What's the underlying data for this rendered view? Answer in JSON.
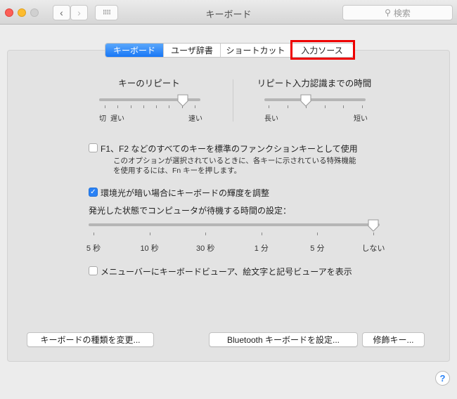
{
  "window": {
    "title": "キーボード",
    "search_placeholder": "検索",
    "colors": {
      "close": "#fc5f57",
      "minimize": "#fdbc2e",
      "zoom": "#d0d0d0",
      "accent": "#1877f6",
      "highlight": "#e00000"
    }
  },
  "tabs": [
    {
      "label": "キーボード",
      "active": true
    },
    {
      "label": "ユーザ辞書",
      "active": false
    },
    {
      "label": "ショートカット",
      "active": false
    },
    {
      "label": "入力ソース",
      "active": false,
      "highlighted": true
    }
  ],
  "key_repeat": {
    "title": "キーのリピート",
    "labels": [
      "切",
      "遅い",
      "速い"
    ],
    "ticks": 8,
    "value_index": 6
  },
  "repeat_delay": {
    "title": "リピート入力認識までの時間",
    "labels": [
      "長い",
      "短い"
    ],
    "ticks": 6,
    "value_index": 2
  },
  "fn_option": {
    "checked": false,
    "label": "F1、F2 などのすべてのキーを標準のファンクションキーとして使用",
    "desc1": "このオプションが選択されているときに、各キーに示されている特殊機能",
    "desc2": "を使用するには、Fn キーを押します。"
  },
  "backlight_option": {
    "checked": true,
    "label": "環境光が暗い場合にキーボードの輝度を調整"
  },
  "idle": {
    "label": "発光した状態でコンピュータが待機する時間の設定：",
    "ticks": [
      "5 秒",
      "10 秒",
      "30 秒",
      "1 分",
      "5 分",
      "しない"
    ],
    "value": "しない"
  },
  "viewer_option": {
    "checked": false,
    "label": "メニューバーにキーボードビューア、絵文字と記号ビューアを表示"
  },
  "buttons": {
    "change_type": "キーボードの種類を変更...",
    "bluetooth": "Bluetooth キーボードを設定...",
    "modifier": "修飾キー..."
  },
  "help": "?"
}
